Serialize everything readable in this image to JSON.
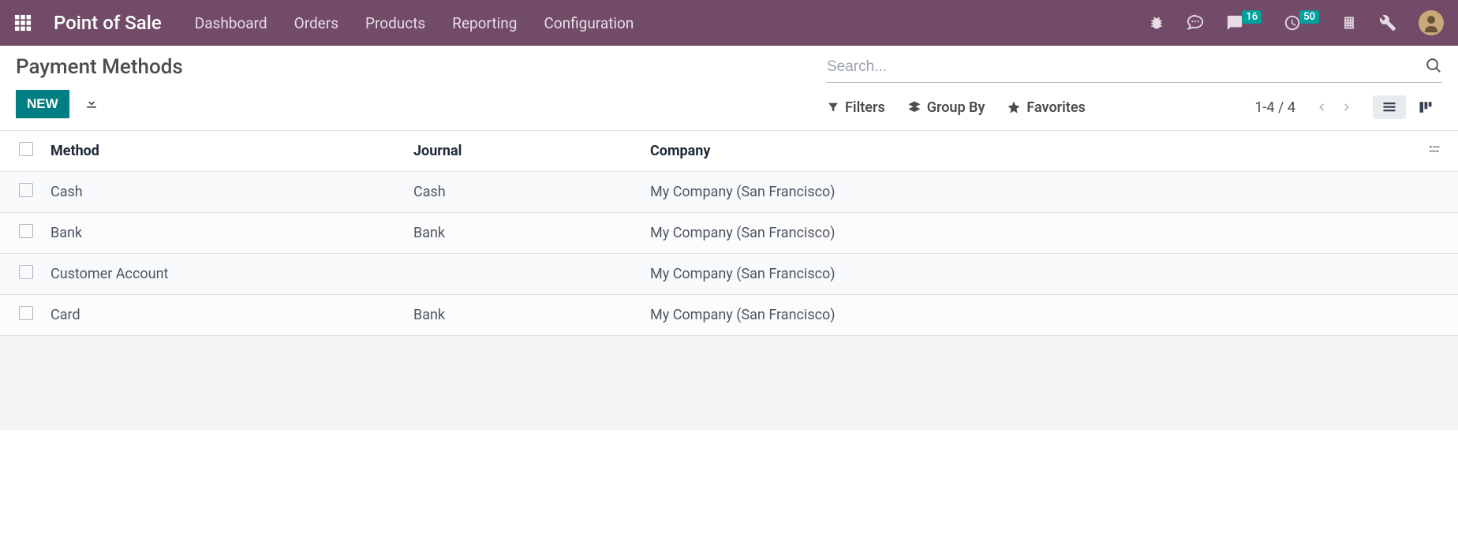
{
  "navbar": {
    "app_title": "Point of Sale",
    "menu": [
      "Dashboard",
      "Orders",
      "Products",
      "Reporting",
      "Configuration"
    ],
    "badges": {
      "messages": "16",
      "activities": "50"
    }
  },
  "page": {
    "title": "Payment Methods",
    "new_label": "NEW",
    "search_placeholder": "Search..."
  },
  "toolbar": {
    "filters_label": "Filters",
    "groupby_label": "Group By",
    "favorites_label": "Favorites",
    "pager": "1-4 / 4"
  },
  "table": {
    "headers": {
      "method": "Method",
      "journal": "Journal",
      "company": "Company"
    },
    "rows": [
      {
        "method": "Cash",
        "journal": "Cash",
        "company": "My Company (San Francisco)"
      },
      {
        "method": "Bank",
        "journal": "Bank",
        "company": "My Company (San Francisco)"
      },
      {
        "method": "Customer Account",
        "journal": "",
        "company": "My Company (San Francisco)"
      },
      {
        "method": "Card",
        "journal": "Bank",
        "company": "My Company (San Francisco)"
      }
    ]
  }
}
